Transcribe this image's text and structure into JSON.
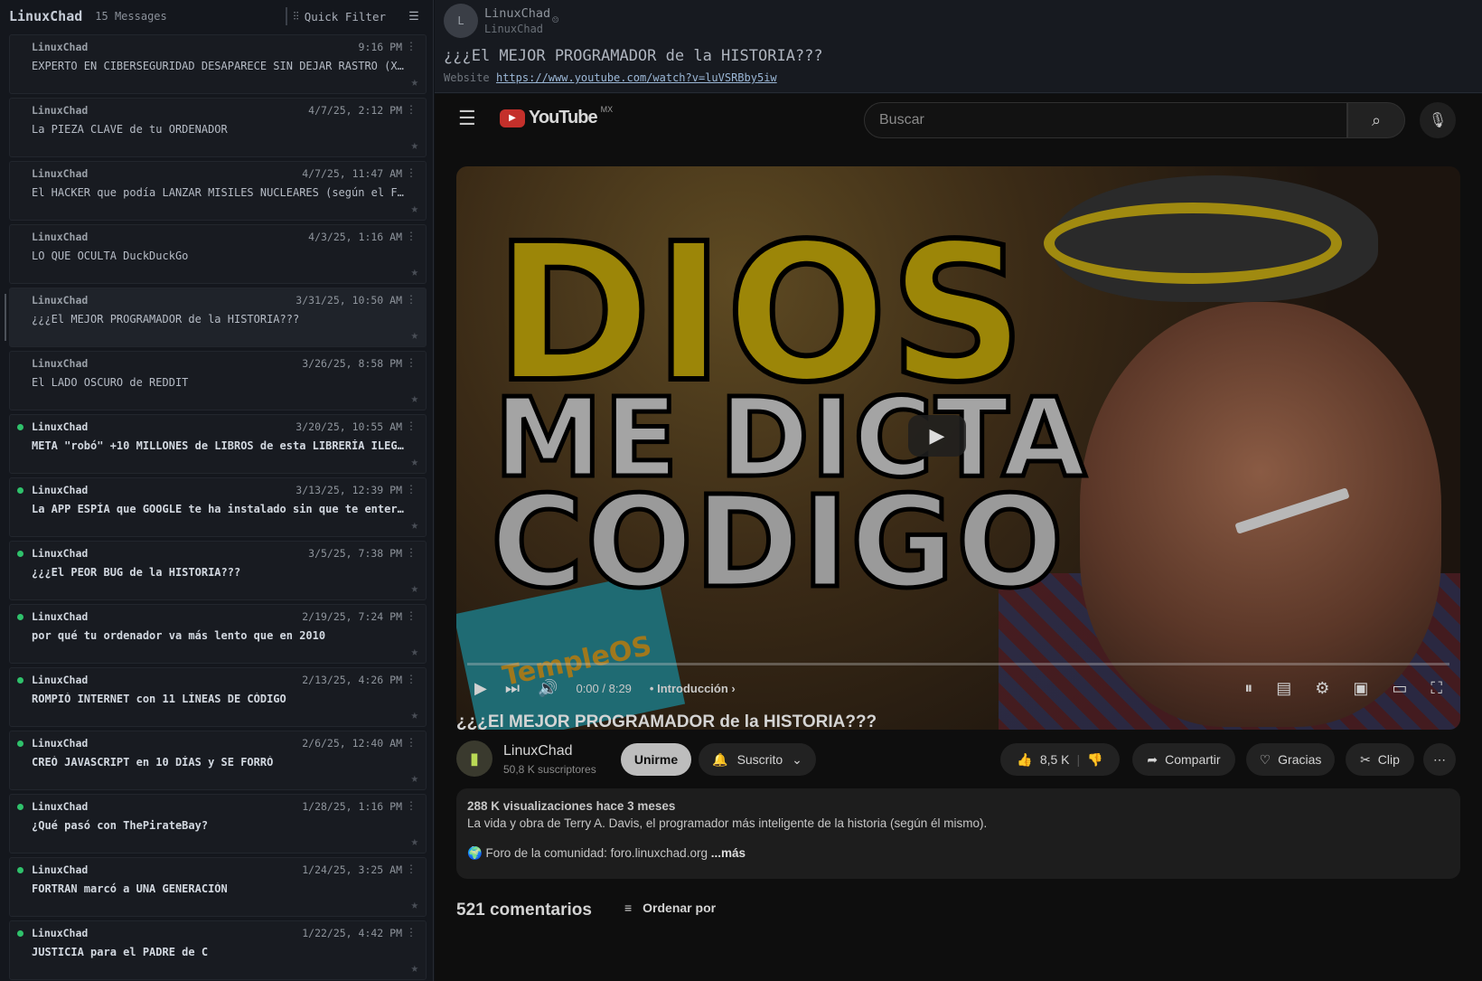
{
  "left": {
    "title": "LinuxChad",
    "count": "15 Messages",
    "quick_filter": "Quick Filter",
    "messages": [
      {
        "author": "LinuxChad",
        "date": "9:16 PM",
        "subject": "EXPERTO EN CIBERSEGURIDAD DESAPARECE SIN DEJAR RASTRO (X…",
        "unread": false
      },
      {
        "author": "LinuxChad",
        "date": "4/7/25, 2:12 PM",
        "subject": "La PIEZA CLAVE de tu ORDENADOR",
        "unread": false
      },
      {
        "author": "LinuxChad",
        "date": "4/7/25, 11:47 AM",
        "subject": "El HACKER que podía LANZAR MISILES NUCLEARES (según el F…",
        "unread": false
      },
      {
        "author": "LinuxChad",
        "date": "4/3/25, 1:16 AM",
        "subject": "LO QUE OCULTA DuckDuckGo",
        "unread": false
      },
      {
        "author": "LinuxChad",
        "date": "3/31/25, 10:50 AM",
        "subject": "¿¿¿El MEJOR PROGRAMADOR de la HISTORIA???",
        "unread": false
      },
      {
        "author": "LinuxChad",
        "date": "3/26/25, 8:58 PM",
        "subject": "El LADO OSCURO de REDDIT",
        "unread": false
      },
      {
        "author": "LinuxChad",
        "date": "3/20/25, 10:55 AM",
        "subject": "META \"robó\" +10 MILLONES de LIBROS de esta LIBRERÍA ILEG…",
        "unread": true
      },
      {
        "author": "LinuxChad",
        "date": "3/13/25, 12:39 PM",
        "subject": "La APP ESPÍA que GOOGLE te ha instalado sin que te enter…",
        "unread": true
      },
      {
        "author": "LinuxChad",
        "date": "3/5/25, 7:38 PM",
        "subject": "¿¿¿El PEOR BUG de la HISTORIA???",
        "unread": true
      },
      {
        "author": "LinuxChad",
        "date": "2/19/25, 7:24 PM",
        "subject": "por qué tu ordenador va más lento que en 2010",
        "unread": true
      },
      {
        "author": "LinuxChad",
        "date": "2/13/25, 4:26 PM",
        "subject": "ROMPIÓ INTERNET con 11 LÍNEAS DE CÓDIGO",
        "unread": true
      },
      {
        "author": "LinuxChad",
        "date": "2/6/25, 12:40 AM",
        "subject": "CREÓ JAVASCRIPT en 10 DÍAS y SE FORRÓ",
        "unread": true
      },
      {
        "author": "LinuxChad",
        "date": "1/28/25, 1:16 PM",
        "subject": "¿Qué pasó con ThePirateBay?",
        "unread": true
      },
      {
        "author": "LinuxChad",
        "date": "1/24/25, 3:25 AM",
        "subject": "FORTRAN marcó a UNA GENERACIÓN",
        "unread": true
      },
      {
        "author": "LinuxChad",
        "date": "1/22/25, 4:42 PM",
        "subject": "JUSTICIA para el PADRE de C",
        "unread": true
      }
    ]
  },
  "header": {
    "avatar_letter": "L",
    "name": "LinuxChad",
    "handle": "LinuxChad",
    "subject": "¿¿¿El MEJOR PROGRAMADOR de la HISTORIA???",
    "website_label": "Website",
    "url": "https://www.youtube.com/watch?v=luVSRBby5iw"
  },
  "yt": {
    "logo_text": "YouTube",
    "region": "MX",
    "search_placeholder": "Buscar",
    "thumb": {
      "w1": "DIOS",
      "w2": "ME DICTA",
      "w3": "CODIGO",
      "tag": "TempleOS"
    },
    "time": "0:00 / 8:29",
    "chapter": "• Introducción ›",
    "title": "¿¿¿El MEJOR PROGRAMADOR de la HISTORIA???",
    "channel": "LinuxChad",
    "subs": "50,8 K suscriptores",
    "join": "Unirme",
    "subscribed": "Suscrito",
    "likes": "8,5 K",
    "share": "Compartir",
    "thanks": "Gracias",
    "clip": "Clip",
    "desc_meta": "288 K visualizaciones  hace 3 meses",
    "desc_line": "La vida y obra de Terry A. Davis, el programador más inteligente de la historia (según él mismo).",
    "desc_forum": "🌍 Foro de la comunidad: foro.linuxchad.org",
    "desc_more": " ...más",
    "comments": "521 comentarios",
    "sort": "Ordenar por"
  }
}
